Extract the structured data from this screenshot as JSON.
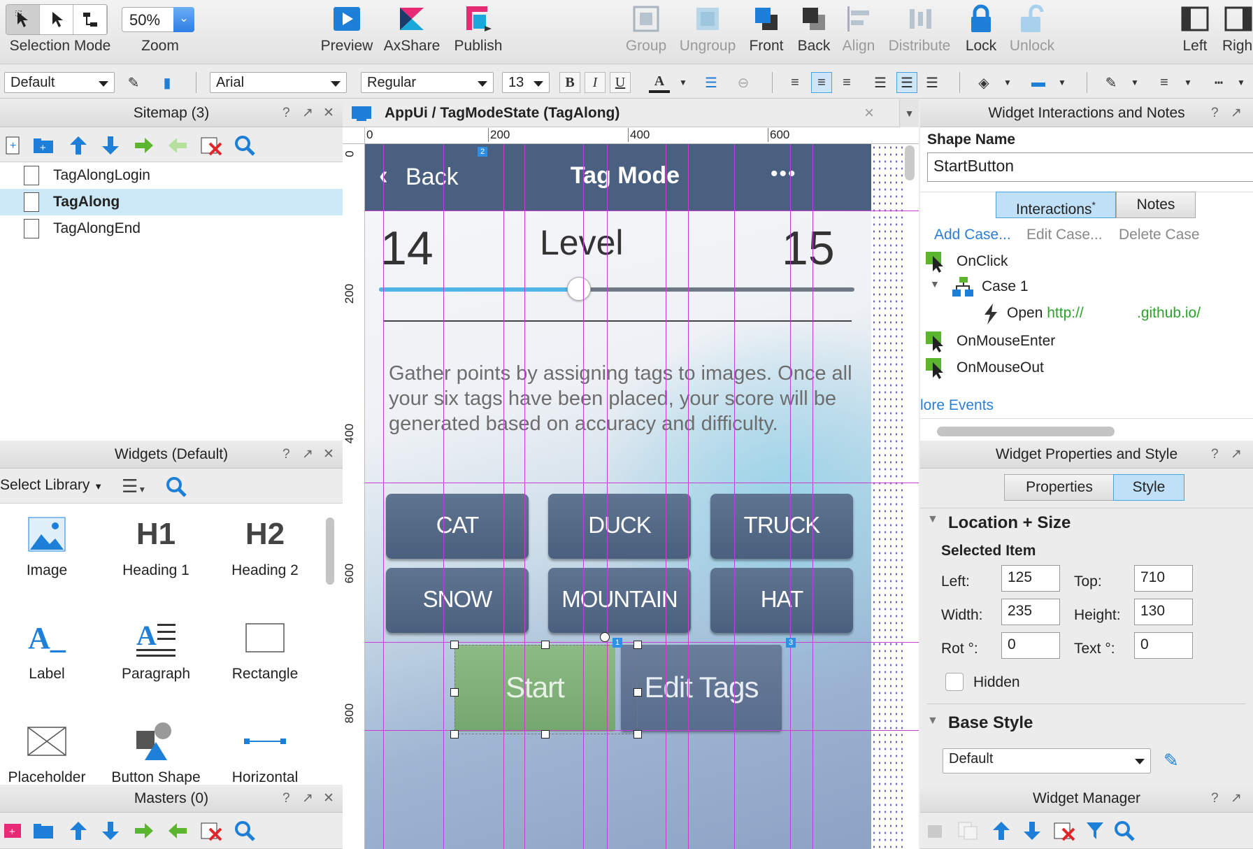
{
  "toolbar": {
    "selection_mode": "Selection Mode",
    "zoom_label": "Zoom",
    "zoom_value": "50%",
    "preview": "Preview",
    "axshare": "AxShare",
    "publish": "Publish",
    "group": "Group",
    "ungroup": "Ungroup",
    "front": "Front",
    "back": "Back",
    "align": "Align",
    "distribute": "Distribute",
    "lock": "Lock",
    "unlock": "Unlock",
    "left": "Left",
    "right": "Righ"
  },
  "format_bar": {
    "style": "Default",
    "font": "Arial",
    "weight": "Regular",
    "size": "13",
    "bold": "B",
    "italic": "I",
    "underline": "U",
    "text_color": "A"
  },
  "sitemap": {
    "title": "Sitemap (3)",
    "help": "?",
    "pages": [
      {
        "label": "TagAlongLogin",
        "active": false
      },
      {
        "label": "TagAlong",
        "active": true
      },
      {
        "label": "TagAlongEnd",
        "active": false
      }
    ]
  },
  "widgets": {
    "title": "Widgets (Default)",
    "help": "?",
    "select_library": "Select Library",
    "items": [
      {
        "label": "Image",
        "icon": "image-icon"
      },
      {
        "label": "Heading 1",
        "icon": "heading1-icon",
        "glyph": "H1"
      },
      {
        "label": "Heading 2",
        "icon": "heading2-icon",
        "glyph": "H2"
      },
      {
        "label": "Label",
        "icon": "label-icon",
        "glyph": "A_"
      },
      {
        "label": "Paragraph",
        "icon": "paragraph-icon",
        "glyph": "A"
      },
      {
        "label": "Rectangle",
        "icon": "rectangle-icon"
      },
      {
        "label": "Placeholder",
        "icon": "placeholder-icon"
      },
      {
        "label": "Button Shape",
        "icon": "button-shape-icon"
      },
      {
        "label": "Horizontal",
        "icon": "horizontal-line-icon"
      }
    ]
  },
  "masters": {
    "title": "Masters (0)",
    "help": "?"
  },
  "canvas": {
    "tab_title": "AppUi / TagModeState (TagAlong)",
    "close": "×",
    "ruler_h": [
      "0",
      "200",
      "400",
      "600"
    ],
    "ruler_v": [
      "0",
      "200",
      "400",
      "600",
      "800"
    ],
    "footnote_markers": [
      "2",
      "1",
      "3"
    ]
  },
  "app": {
    "back": "Back",
    "title": "Tag Mode",
    "more": "•••",
    "level_left": "14",
    "level_label": "Level",
    "level_right": "15",
    "level_progress": 0.42,
    "description": "Gather points by assigning tags to images. Once all your six tags have been placed, your score will be generated based on accuracy and difficulty.",
    "tags": [
      "CAT",
      "DUCK",
      "TRUCK",
      "SNOW",
      "MOUNTAIN",
      "HAT"
    ],
    "start": "Start",
    "edit_tags": "Edit Tags"
  },
  "interactions": {
    "title": "Widget Interactions and Notes",
    "help": "?",
    "shape_name_label": "Shape Name",
    "shape_name": "StartButton",
    "tab_interactions": "Interactions",
    "tab_notes": "Notes",
    "star": "*",
    "add_case": "Add Case...",
    "edit_case": "Edit Case...",
    "delete_case": "Delete Case",
    "on_click": "OnClick",
    "case1": "Case 1",
    "open": "Open",
    "url_start": "http://",
    "url_end": ".github.io/",
    "on_mouse_enter": "OnMouseEnter",
    "on_mouse_out": "OnMouseOut",
    "more_events": "lore Events"
  },
  "properties": {
    "title": "Widget Properties and Style",
    "help": "?",
    "tab_properties": "Properties",
    "tab_style": "Style",
    "location_size": "Location + Size",
    "selected_item": "Selected Item",
    "left_label": "Left:",
    "left": "125",
    "top_label": "Top:",
    "top": "710",
    "width_label": "Width:",
    "width": "235",
    "height_label": "Height:",
    "height": "130",
    "rot_label": "Rot °:",
    "rot": "0",
    "text_label": "Text °:",
    "text": "0",
    "hidden": "Hidden",
    "base_style": "Base Style",
    "base_style_value": "Default"
  },
  "widget_manager": {
    "title": "Widget Manager",
    "help": "?"
  },
  "colors": {
    "accent_blue": "#2f7ee6",
    "guide": "#c93cd2",
    "nav": "#4a6080",
    "start_green": "#7fae7a",
    "link": "#2a7fd4",
    "url_green": "#2ea12e"
  }
}
